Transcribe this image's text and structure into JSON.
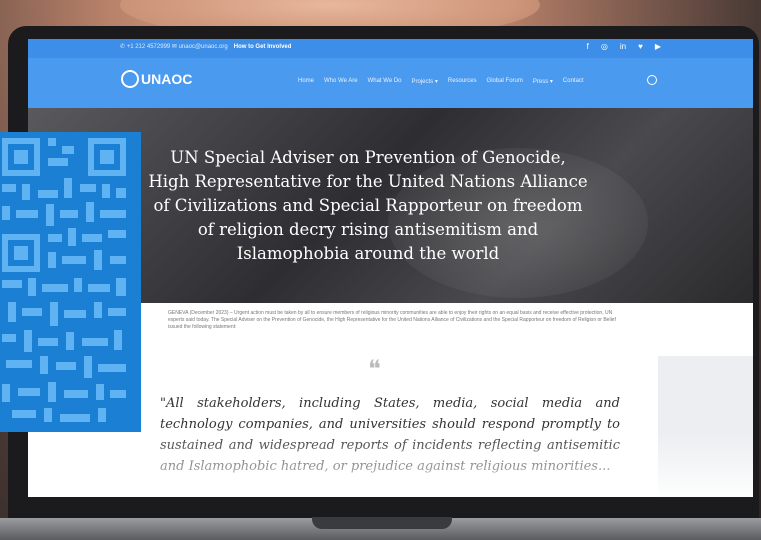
{
  "topbar": {
    "contact": "✆ +1 212 4572999  ✉ unaoc@unaoc.org",
    "contact_link": "How to Get Involved"
  },
  "social_icons": [
    "facebook-icon",
    "instagram-icon",
    "linkedin-icon",
    "twitter-icon",
    "youtube-icon"
  ],
  "logo": {
    "text": "UNAOC"
  },
  "nav": {
    "items": [
      "Home",
      "Who We Are",
      "What We Do",
      "Projects ▾",
      "Resources",
      "Global Forum",
      "Press ▾",
      "Contact"
    ]
  },
  "hero": {
    "title": "UN Special Adviser on Prevention of Genocide, High Representative for the United Nations Alliance of Civilizations and Special Rapporteur on freedom of religion decry rising antisemitism and Islamophobia around the world"
  },
  "article": {
    "intro": "GENEVA (December 2023) – Urgent action must be taken by all to ensure members of religious minority communities are able to enjoy their rights on an equal basis and receive effective protection, UN experts said today. The Special Adviser on the Prevention of Genocide, the High Representative for the United Nations Alliance of Civilizations and the Special Rapporteur on freedom of Religion or Belief issued the following statement:",
    "quote_mark": "❝",
    "quote": "\"All stakeholders, including States, media, social media and technology companies, and universities should respond promptly to sustained and widespread reports of incidents reflecting antisemitic and Islamophobic hatred, or prejudice against religious minorities..."
  },
  "colors": {
    "topbar": "#3d8ee8",
    "navbar": "#4a9af0",
    "qr": "#1b7fd3"
  }
}
